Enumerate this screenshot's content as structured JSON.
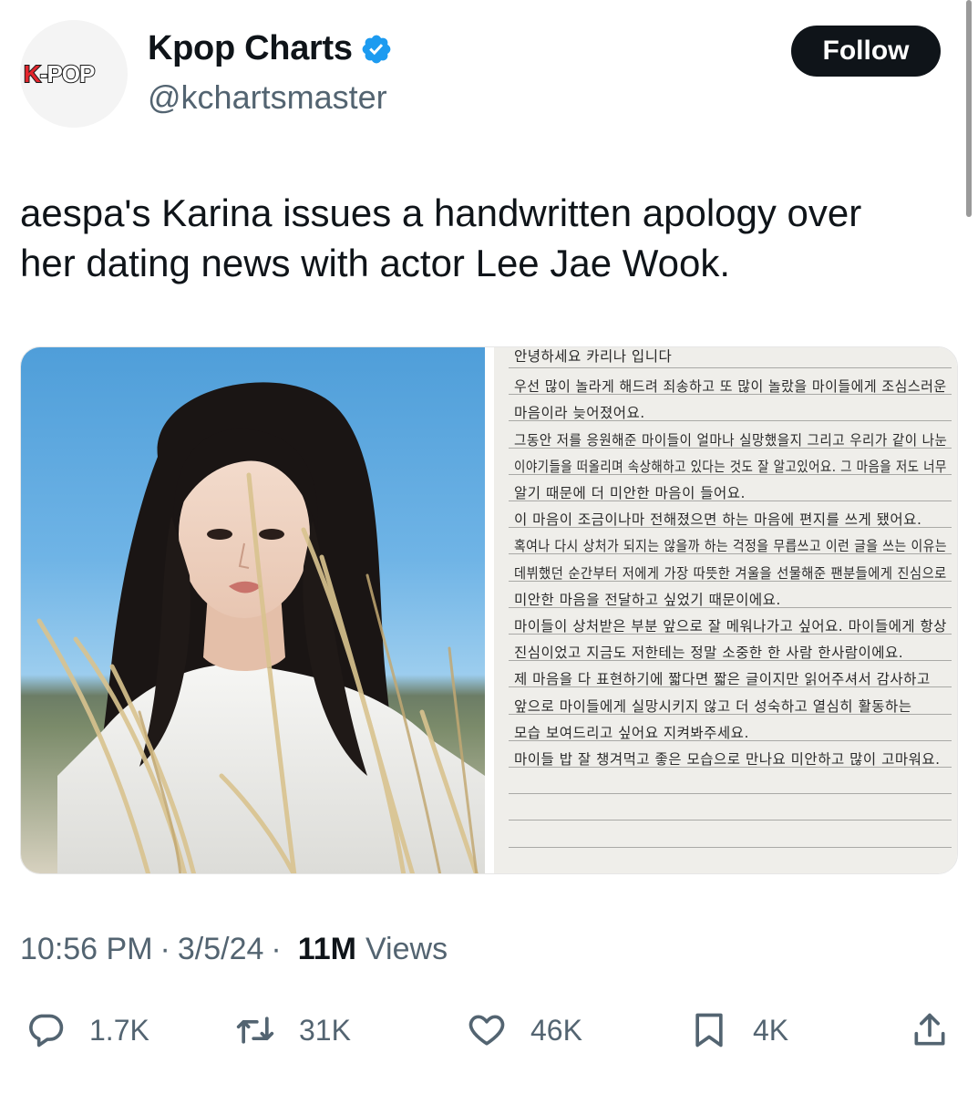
{
  "author": {
    "avatar_text": "K-POP",
    "display_name": "Kpop Charts",
    "verified": true,
    "handle": "@kchartsmaster"
  },
  "follow_label": "Follow",
  "tweet": {
    "text_line1": "aespa's Karina issues a handwritten apology over",
    "text_line2": "her dating news with actor Lee Jae Wook."
  },
  "letter": {
    "lines": [
      "안녕하세요 카리나 입니다",
      "우선 많이 놀라게 해드려 죄송하고 또 많이 놀랐을 마이들에게 조심스러운",
      "마음이라 늦어졌어요.",
      "그동안 저를 응원해준 마이들이 얼마나 실망했을지 그리고 우리가 같이 나눈",
      "이야기들을 떠올리며 속상해하고 있다는 것도 잘 알고있어요. 그 마음을 저도 너무",
      "알기 때문에 더 미안한 마음이 들어요.",
      "이 마음이 조금이나마 전해졌으면 하는 마음에 편지를 쓰게 됐어요.",
      "혹여나 다시 상처가 되지는 않을까 하는 걱정을 무릅쓰고 이런 글을 쓰는 이유는",
      "데뷔했던 순간부터 저에게 가장 따뜻한 겨울을 선물해준 팬분들에게 진심으로",
      "미안한 마음을 전달하고 싶었기 때문이에요.",
      "마이들이 상처받은 부분 앞으로 잘 메워나가고 싶어요. 마이들에게 항상",
      "진심이었고 지금도 저한테는 정말 소중한 한 사람 한사람이에요.",
      "제 마음을 다 표현하기에 짧다면 짧은 글이지만 읽어주셔서 감사하고",
      "앞으로 마이들에게 실망시키지 않고 더 성숙하고 열심히 활동하는",
      "모습 보여드리고 싶어요 지켜봐주세요.",
      "마이들 밥 잘 챙겨먹고 좋은 모습으로 만나요 미안하고 많이 고마워요."
    ]
  },
  "meta": {
    "time": "10:56 PM",
    "separator": "·",
    "date": "3/5/24",
    "views_count": "11M",
    "views_label": "Views"
  },
  "actions": {
    "replies": "1.7K",
    "reposts": "31K",
    "likes": "46K",
    "bookmarks": "4K"
  },
  "colors": {
    "text_primary": "#0f1419",
    "text_secondary": "#536471",
    "verified_blue": "#1d9bf0",
    "follow_bg": "#0f1419"
  }
}
